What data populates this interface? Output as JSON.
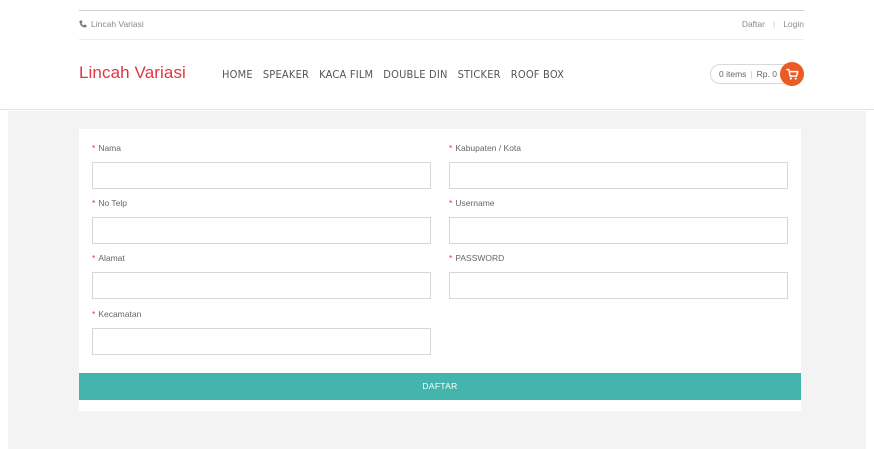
{
  "topbar": {
    "phone_label": "Lincah Variasi",
    "register_label": "Daftar",
    "separator": "|",
    "login_label": "Login"
  },
  "header": {
    "brand": "Lincah Variasi",
    "nav": [
      "HOME",
      "SPEAKER",
      "KACA FILM",
      "DOUBLE DIN",
      "STICKER",
      "ROOF BOX"
    ],
    "cart": {
      "items_label": "0 items",
      "separator": "|",
      "total_label": "Rp. 0"
    }
  },
  "form": {
    "required_mark": "*",
    "fields": {
      "nama": {
        "label": "Nama",
        "value": ""
      },
      "no_telp": {
        "label": "No Telp",
        "value": ""
      },
      "alamat": {
        "label": "Alamat",
        "value": ""
      },
      "kecamatan": {
        "label": "Kecamatan",
        "value": ""
      },
      "kabupaten": {
        "label": "Kabupaten / Kota",
        "value": ""
      },
      "username": {
        "label": "Username",
        "value": ""
      },
      "password": {
        "label": "PASSWORD",
        "value": ""
      }
    },
    "submit_label": "DAFTAR"
  },
  "colors": {
    "brand": "#e0373e",
    "required": "#e0373e",
    "submit_bg": "#44b5ac",
    "cart_button": "#ee5a24"
  },
  "icons": {
    "phone": "phone-icon",
    "cart": "shopping-cart-icon"
  }
}
